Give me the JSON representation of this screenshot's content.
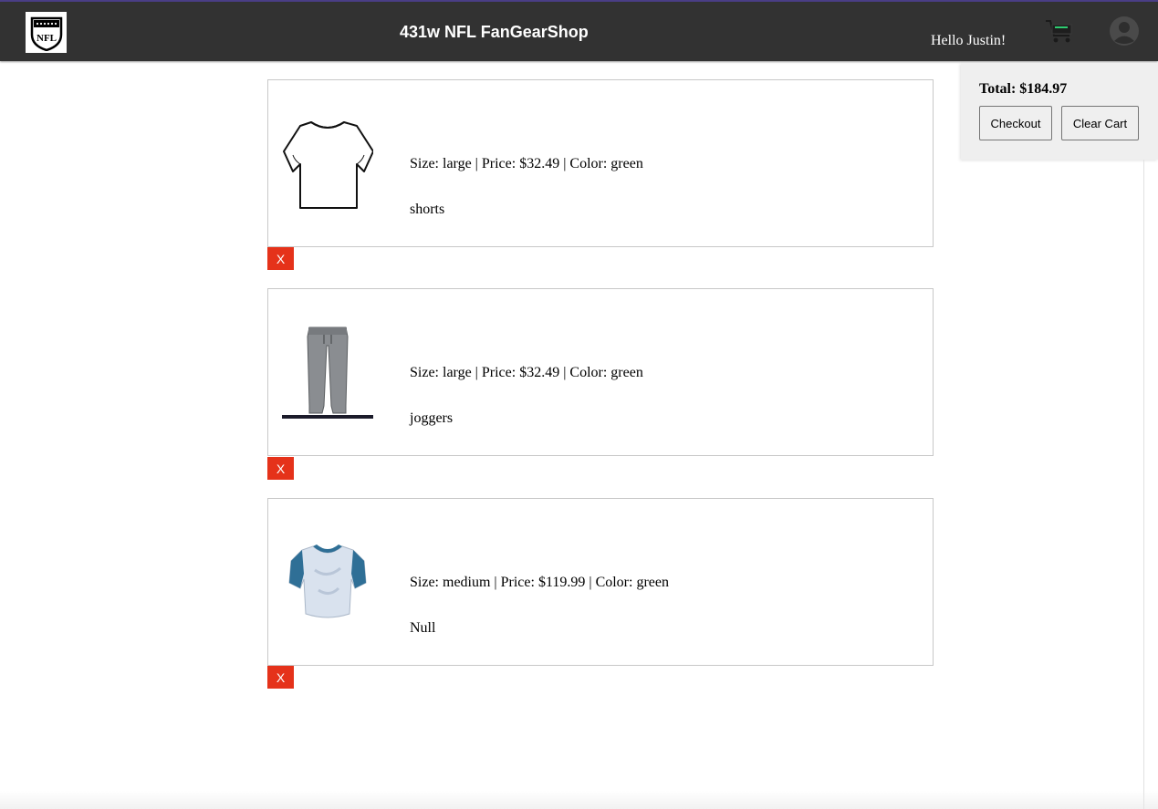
{
  "header": {
    "title": "431w NFL FanGearShop",
    "greeting": "Hello Justin!",
    "logo_text": "NFL"
  },
  "cart": {
    "total": "Total: $184.97",
    "checkout_label": "Checkout",
    "clear_label": "Clear Cart"
  },
  "items": [
    {
      "details": "Size: large | Price: $32.49 | Color: green",
      "name": "shorts",
      "image": "white-tshirt",
      "remove_label": "X"
    },
    {
      "details": "Size: large | Price: $32.49 | Color: green",
      "name": "joggers",
      "image": "gray-joggers",
      "remove_label": "X"
    },
    {
      "details": "Size: medium | Price: $119.99 | Color: green",
      "name": "Null",
      "image": "blue-jersey",
      "remove_label": "X"
    }
  ],
  "colors": {
    "navbar": "#323232",
    "remove_button": "#e5321a",
    "cart_accent": "#2ecc71",
    "panel": "#efefef"
  }
}
